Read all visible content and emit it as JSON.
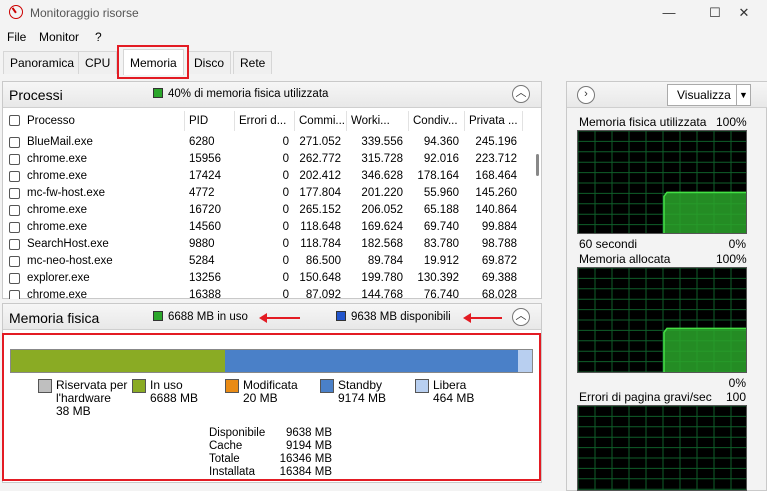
{
  "window": {
    "title": "Monitoraggio risorse",
    "minimize": "—",
    "maximize": "☐",
    "close": "✕"
  },
  "menu": [
    "File",
    "Monitor",
    "?"
  ],
  "tabs": [
    {
      "label": "Panoramica",
      "active": false
    },
    {
      "label": "CPU",
      "active": false
    },
    {
      "label": "Memoria",
      "active": true
    },
    {
      "label": "Disco",
      "active": false
    },
    {
      "label": "Rete",
      "active": false
    }
  ],
  "processi": {
    "title": "Processi",
    "status": "40% di memoria fisica utilizzata",
    "collapse_icon": "chevron-up-icon",
    "columns": [
      "Processo",
      "PID",
      "Errori d...",
      "Commi...",
      "Worki...",
      "Condiv...",
      "Privata ..."
    ],
    "rows": [
      [
        "BlueMail.exe",
        "6280",
        "0",
        "271.052",
        "339.556",
        "94.360",
        "245.196"
      ],
      [
        "chrome.exe",
        "15956",
        "0",
        "262.772",
        "315.728",
        "92.016",
        "223.712"
      ],
      [
        "chrome.exe",
        "17424",
        "0",
        "202.412",
        "346.628",
        "178.164",
        "168.464"
      ],
      [
        "mc-fw-host.exe",
        "4772",
        "0",
        "177.804",
        "201.220",
        "55.960",
        "145.260"
      ],
      [
        "chrome.exe",
        "16720",
        "0",
        "265.152",
        "206.052",
        "65.188",
        "140.864"
      ],
      [
        "chrome.exe",
        "14560",
        "0",
        "118.648",
        "169.624",
        "69.740",
        "99.884"
      ],
      [
        "SearchHost.exe",
        "9880",
        "0",
        "118.784",
        "182.568",
        "83.780",
        "98.788"
      ],
      [
        "mc-neo-host.exe",
        "5284",
        "0",
        "86.500",
        "89.784",
        "19.912",
        "69.872"
      ],
      [
        "explorer.exe",
        "13256",
        "0",
        "150.648",
        "199.780",
        "130.392",
        "69.388"
      ],
      [
        "chrome.exe",
        "16388",
        "0",
        "87.092",
        "144.768",
        "76.740",
        "68.028"
      ]
    ]
  },
  "memoria_fisica": {
    "title": "Memoria fisica",
    "in_uso_header": "6688 MB in uso",
    "disponibili_header": "9638 MB disponibili",
    "segments": [
      {
        "name": "Riservata per l'hardware",
        "mb": 38,
        "color": "#bfbfbf"
      },
      {
        "name": "In uso",
        "mb": 6688,
        "color": "#8aab24"
      },
      {
        "name": "Modificata",
        "mb": 20,
        "color": "#e98b15"
      },
      {
        "name": "Standby",
        "mb": 9174,
        "color": "#4a80c8"
      },
      {
        "name": "Libera",
        "mb": 464,
        "color": "#b8cff0"
      }
    ],
    "legend": [
      {
        "label": "Riservata per\nl'hardware",
        "value": "38 MB",
        "color": "#bfbfbf"
      },
      {
        "label": "In uso",
        "value": "6688 MB",
        "color": "#8aab24"
      },
      {
        "label": "Modificata",
        "value": "20 MB",
        "color": "#e98b15"
      },
      {
        "label": "Standby",
        "value": "9174 MB",
        "color": "#4a80c8"
      },
      {
        "label": "Libera",
        "value": "464 MB",
        "color": "#b8cff0"
      }
    ],
    "summary": [
      {
        "label": "Disponibile",
        "value": "9638 MB"
      },
      {
        "label": "Cache",
        "value": "9194 MB"
      },
      {
        "label": "Totale",
        "value": "16346 MB"
      },
      {
        "label": "Installata",
        "value": "16384 MB"
      }
    ]
  },
  "right_panel": {
    "expand_icon": "chevron-right-icon",
    "view_button": "Visualizza",
    "graphs": [
      {
        "title": "Memoria fisica utilizzata",
        "max": "100%",
        "left_footer": "60 secondi",
        "right_footer": "0%",
        "level": 0.41
      },
      {
        "title": "Memoria allocata",
        "max": "100%",
        "left_footer": "",
        "right_footer": "0%",
        "level": 0.43
      },
      {
        "title": "Errori di pagina gravi/sec",
        "max": "100",
        "left_footer": "",
        "right_footer": "",
        "level": 0
      }
    ]
  },
  "colors": {
    "highlight": "#e31b23",
    "graph_fill": "#2aa52a",
    "graph_grid": "#0f5e2a"
  }
}
